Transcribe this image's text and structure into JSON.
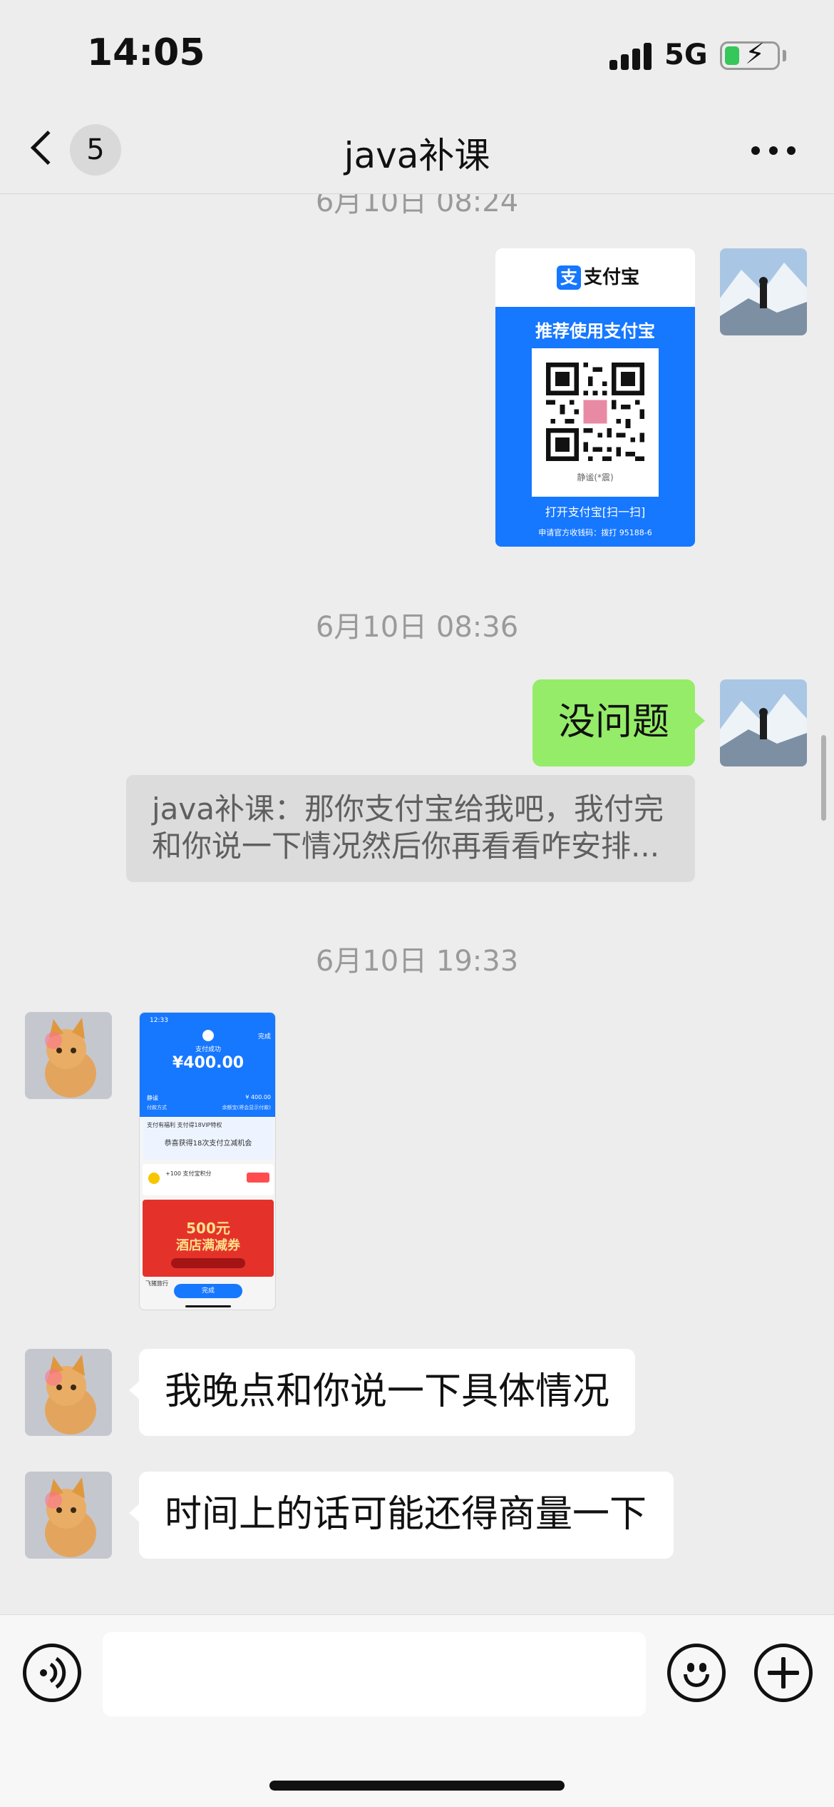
{
  "status_bar": {
    "time": "14:05",
    "network": "5G"
  },
  "header": {
    "back_badge": "5",
    "title": "java补课"
  },
  "chat": {
    "timestamp_partial": "6月10日 08:24",
    "qr_card": {
      "brand": "支付宝",
      "logo": "支",
      "heading": "推荐使用支付宝",
      "name": "静谧(*震)",
      "open_text": "打开支付宝[扫一扫]",
      "hotline": "申请官方收钱码：拨打 95188-6"
    },
    "timestamp_2": "6月10日 08:36",
    "msg_me": "没问题",
    "quote_line1": "java补课：那你支付宝给我吧，我付完",
    "quote_line2": "和你说一下情况然后你再看看咋安排...",
    "timestamp_3": "6月10日 19:33",
    "receipt": {
      "time": "12:33",
      "top_done": "完成",
      "status": "支付成功",
      "amount": "¥400.00",
      "payee": "静谧",
      "amount_small": "¥ 400.00",
      "method_label": "付款方式",
      "method_value": "余额宝(将会显示付款)",
      "benefit_title": "支付有福利  支付得18VIP特权",
      "benefit_main": "恭喜获得18次支付立减机会",
      "points_text": "+100 支付宝积分",
      "hotel_big": "500元",
      "hotel_sub": "酒店满减券",
      "fliggy": "飞猪旅行",
      "done": "完成"
    },
    "msg_them_1": "我晚点和你说一下具体情况",
    "msg_them_2": "时间上的话可能还得商量一下"
  },
  "input": {
    "placeholder": ""
  },
  "colors": {
    "me_bubble": "#95ec69",
    "alipay_blue": "#1677ff",
    "background": "#ededed"
  }
}
